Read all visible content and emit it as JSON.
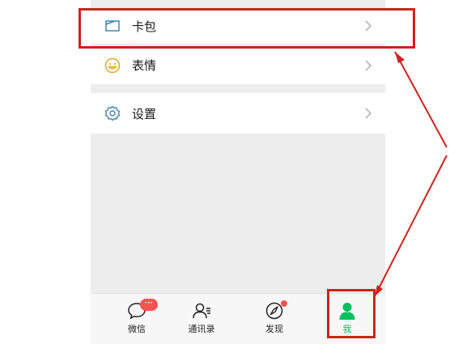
{
  "menu": {
    "items": [
      {
        "label": "卡包",
        "icon": "card-wallet-icon"
      },
      {
        "label": "表情",
        "icon": "sticker-smile-icon"
      },
      {
        "label": "设置",
        "icon": "settings-gear-icon"
      }
    ]
  },
  "tabbar": {
    "tabs": [
      {
        "label": "微信",
        "icon": "chat-icon",
        "badge": "···"
      },
      {
        "label": "通讯录",
        "icon": "contacts-icon"
      },
      {
        "label": "发现",
        "icon": "discover-compass-icon",
        "has_dot": true
      },
      {
        "label": "我",
        "icon": "me-person-icon",
        "active": true
      }
    ]
  },
  "colors": {
    "accent": "#07c160",
    "highlight": "#d0221d",
    "badge": "#fa5151",
    "icon_teal": "#3f89a8"
  }
}
